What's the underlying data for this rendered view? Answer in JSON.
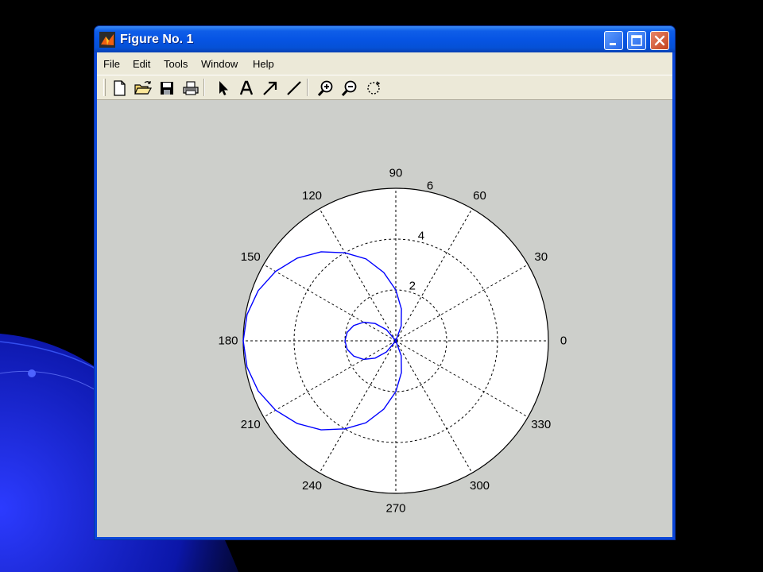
{
  "window": {
    "title": "Figure No. 1",
    "app_icon": "matlab-icon",
    "controls": [
      "minimize-icon",
      "maximize-icon",
      "close-icon"
    ]
  },
  "menubar": {
    "items": [
      {
        "label": "File"
      },
      {
        "label": "Edit"
      },
      {
        "label": "Tools"
      },
      {
        "label": "Window"
      },
      {
        "label": "Help"
      }
    ]
  },
  "toolbar": {
    "tools": [
      {
        "icon": "new-figure-icon"
      },
      {
        "icon": "open-file-icon"
      },
      {
        "icon": "save-icon"
      },
      {
        "icon": "print-icon"
      },
      {
        "icon": "edit-plot-arrow-icon"
      },
      {
        "icon": "insert-text-icon"
      },
      {
        "icon": "insert-arrow-icon"
      },
      {
        "icon": "insert-line-icon"
      },
      {
        "icon": "zoom-in-icon"
      },
      {
        "icon": "zoom-out-icon"
      },
      {
        "icon": "rotate-3d-icon"
      }
    ]
  },
  "colors": {
    "line": "#0000ff",
    "grid": "#000000",
    "axes_background": "#ffffff",
    "figure_background": "#cdcfcb"
  },
  "chart_data": {
    "type": "polar",
    "rlim": [
      0,
      6
    ],
    "r_ticks": [
      2,
      4,
      6
    ],
    "r_tick_labels": [
      "2",
      "4",
      "6"
    ],
    "theta_ticks_deg": [
      0,
      30,
      60,
      90,
      120,
      150,
      180,
      210,
      240,
      270,
      300,
      330
    ],
    "theta_tick_labels": [
      "0",
      "30",
      "60",
      "90",
      "120",
      "150",
      "180",
      "210",
      "240",
      "270",
      "300",
      "330"
    ],
    "grid": true,
    "grid_style": "dashed",
    "series": [
      {
        "line_color": "#0000ff",
        "theta_deg": [
          0,
          10,
          20,
          30,
          40,
          50,
          60,
          70,
          80,
          90,
          100,
          110,
          120,
          130,
          140,
          150,
          160,
          170,
          180,
          190,
          200,
          210,
          220,
          230,
          240,
          250,
          260,
          270,
          280,
          290,
          300,
          310,
          320,
          330,
          340,
          350,
          360
        ],
        "r": [
          -2.0,
          -1.94,
          -1.76,
          -1.46,
          -1.06,
          -0.57,
          0.0,
          0.62,
          1.27,
          2.0,
          2.73,
          3.43,
          4.0,
          4.57,
          5.06,
          5.46,
          5.76,
          5.94,
          6.0,
          5.94,
          5.76,
          5.46,
          5.06,
          4.57,
          4.0,
          3.43,
          2.73,
          2.0,
          1.27,
          0.62,
          0.0,
          -0.57,
          -1.06,
          -1.46,
          -1.76,
          -1.94,
          -2.0
        ]
      }
    ]
  }
}
